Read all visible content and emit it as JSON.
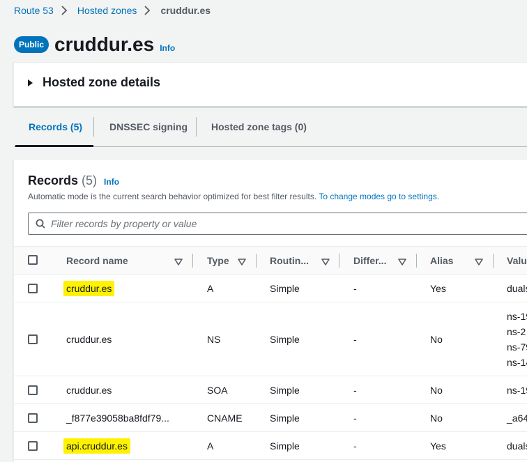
{
  "breadcrumb": {
    "items": [
      "Route 53",
      "Hosted zones"
    ],
    "current": "cruddur.es"
  },
  "header": {
    "badge": "Public",
    "title": "cruddur.es",
    "info": "Info"
  },
  "details": {
    "label": "Hosted zone details"
  },
  "tabs": [
    {
      "label": "Records (5)",
      "active": true
    },
    {
      "label": "DNSSEC signing"
    },
    {
      "label": "Hosted zone tags (0)"
    }
  ],
  "records": {
    "title": "Records",
    "count": "(5)",
    "info": "Info",
    "description": "Automatic mode is the current search behavior optimized for best filter results.",
    "settings_link": "To change modes go to settings.",
    "search_placeholder": "Filter records by property or value",
    "columns": [
      "Record name",
      "Type",
      "Routin...",
      "Differ...",
      "Alias",
      "Valu"
    ],
    "rows": [
      {
        "name": "cruddur.es",
        "type": "A",
        "routing": "Simple",
        "differ": "-",
        "alias": "Yes",
        "values": [
          "duals"
        ],
        "highlight": true
      },
      {
        "name": "cruddur.es",
        "type": "NS",
        "routing": "Simple",
        "differ": "-",
        "alias": "No",
        "values": [
          "ns-19",
          "ns-2",
          "ns-79",
          "ns-14"
        ],
        "highlight": false
      },
      {
        "name": "cruddur.es",
        "type": "SOA",
        "routing": "Simple",
        "differ": "-",
        "alias": "No",
        "values": [
          "ns-19"
        ],
        "highlight": false
      },
      {
        "name": "_f877e39058ba8fdf79...",
        "type": "CNAME",
        "routing": "Simple",
        "differ": "-",
        "alias": "No",
        "values": [
          "_a64"
        ],
        "highlight": false
      },
      {
        "name": "api.cruddur.es",
        "type": "A",
        "routing": "Simple",
        "differ": "-",
        "alias": "Yes",
        "values": [
          "duals"
        ],
        "highlight": true
      }
    ]
  },
  "colors": {
    "link": "#0073bb",
    "highlight": "#fff200",
    "badge": "#0073bb"
  }
}
